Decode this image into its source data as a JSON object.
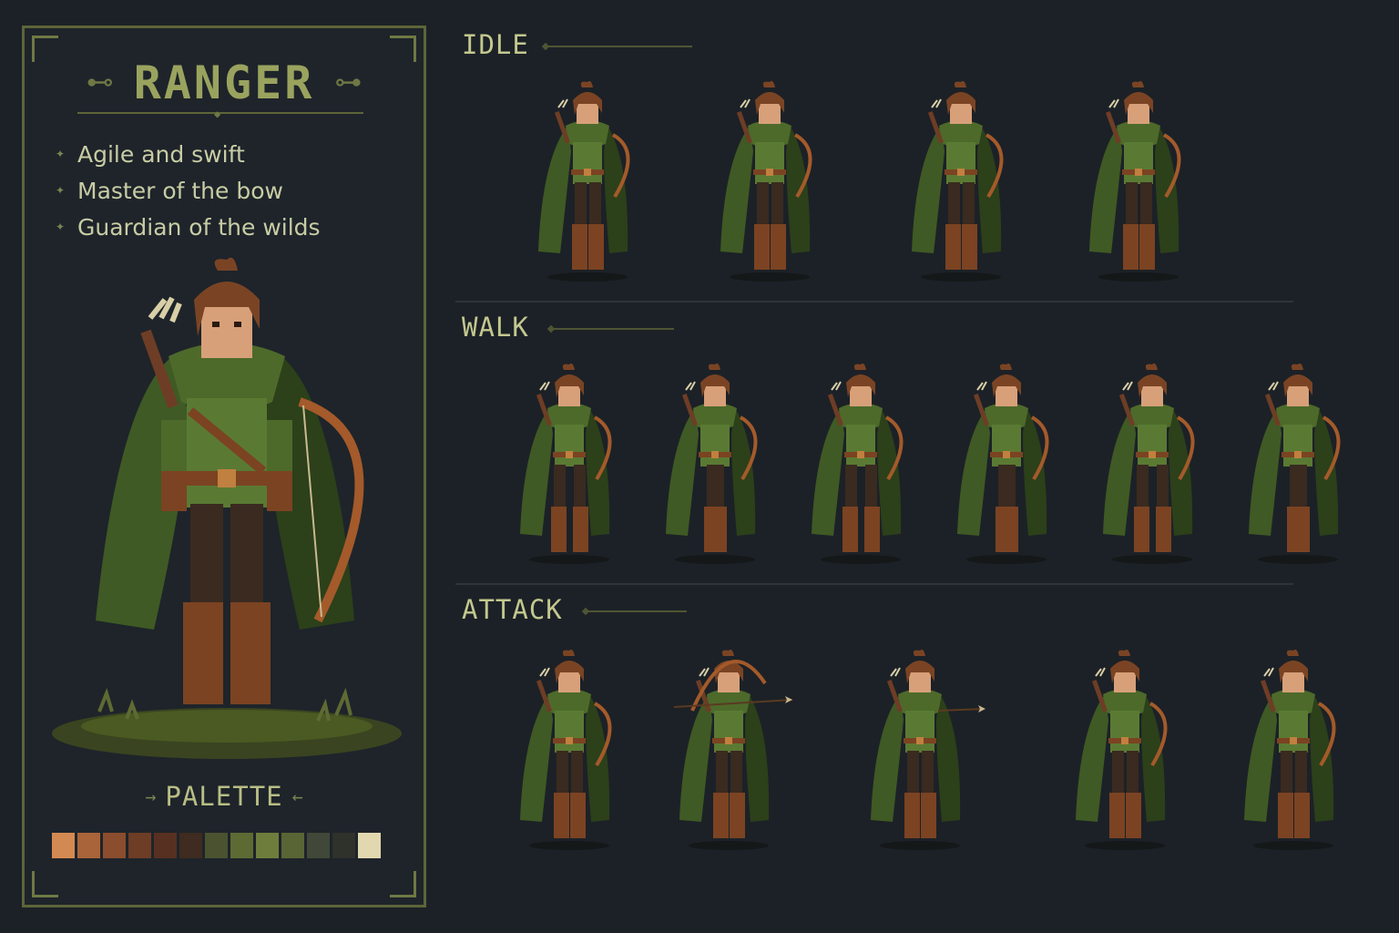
{
  "card": {
    "title": "RANGER",
    "traits": [
      "Agile and swift",
      "Master of the bow",
      "Guardian of the wilds"
    ],
    "palette_label": "PALETTE",
    "palette": [
      "#d38a52",
      "#a9643a",
      "#8a4d2e",
      "#6e3d25",
      "#573021",
      "#3f2b20",
      "#4b5230",
      "#5e6a33",
      "#6f7d3c",
      "#5a6535",
      "#414839",
      "#2f312b",
      "#e2d8b0"
    ]
  },
  "sections": [
    {
      "label": "IDLE",
      "frames": 4
    },
    {
      "label": "WALK",
      "frames": 6
    },
    {
      "label": "ATTACK",
      "frames": 5
    }
  ],
  "colors": {
    "cloak": "#3f5a24",
    "cloak_dark": "#2c401a",
    "tunic": "#5a7a33",
    "skin": "#d7a079",
    "hair": "#7a4424",
    "leather": "#7b4322",
    "pants": "#3a2a20",
    "bow": "#a45a2a",
    "grass": "#4a5a22"
  }
}
